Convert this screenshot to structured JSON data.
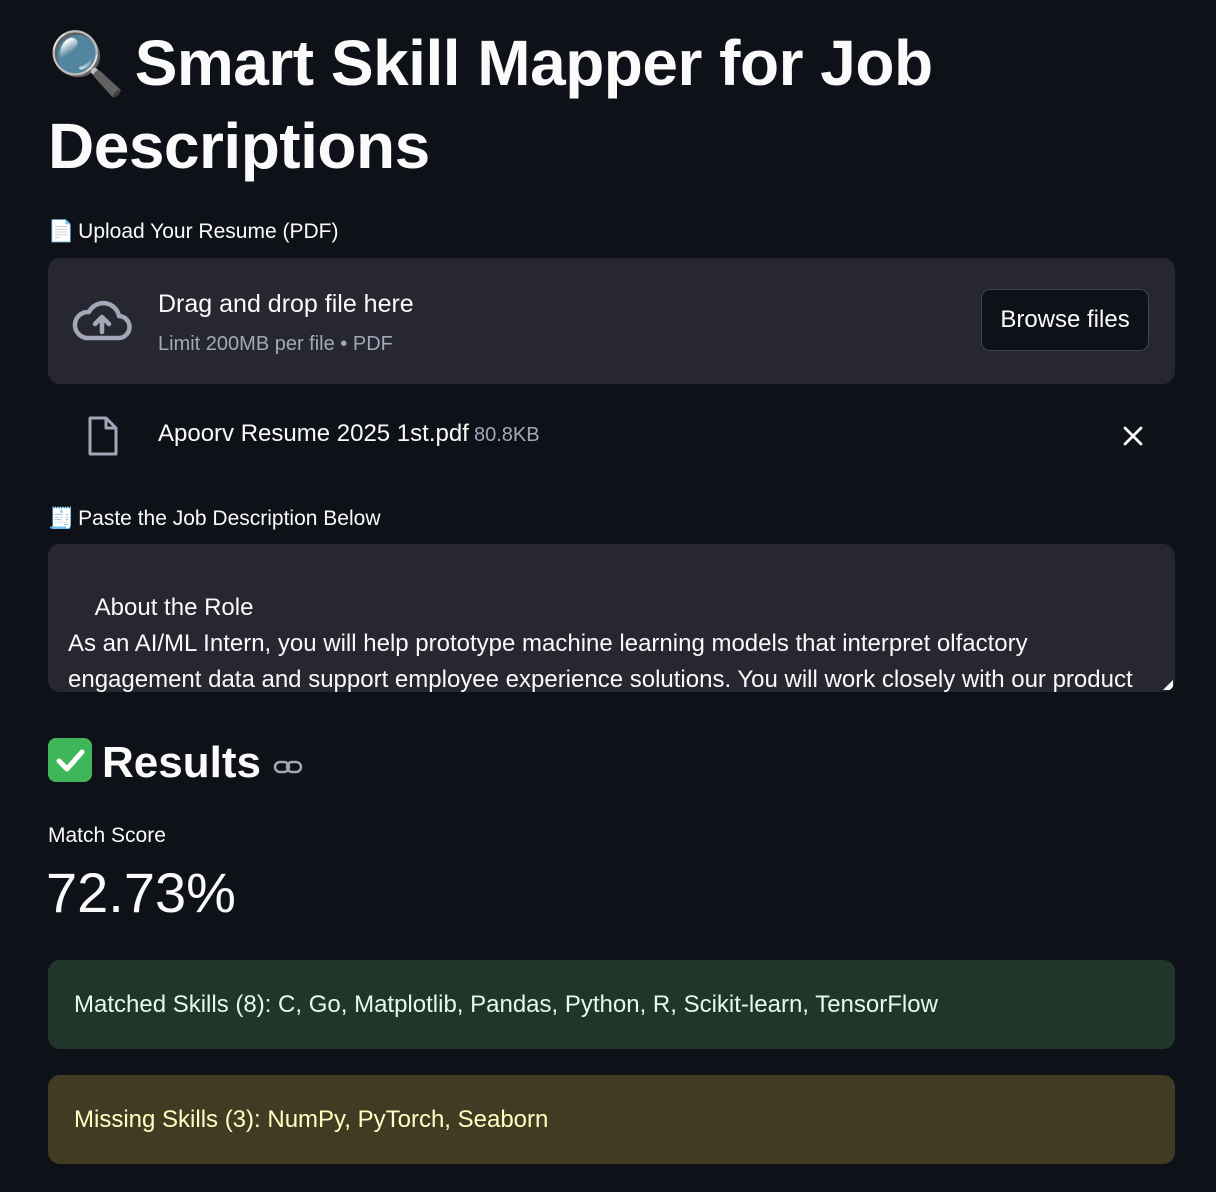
{
  "header": {
    "title_emoji": "🔍",
    "title": "Smart Skill Mapper for Job Descriptions"
  },
  "upload": {
    "label_emoji": "📄",
    "label": "Upload Your Resume (PDF)",
    "dropzone_title": "Drag and drop file here",
    "dropzone_subtitle": "Limit 200MB per file • PDF",
    "browse_label": "Browse files",
    "file": {
      "name": "Apoorv Resume 2025 1st.pdf",
      "size": "80.8KB"
    }
  },
  "job_description": {
    "label_emoji": "🧾",
    "label": "Paste the Job Description Below",
    "value": "About the Role\nAs an AI/ML Intern, you will help prototype machine learning models that interpret olfactory engagement data and support employee experience solutions. You will work closely with our product and technical teams to research, build, and test early-stage models."
  },
  "results": {
    "heading": "Results",
    "metric_label": "Match Score",
    "metric_value": "72.73%",
    "matched": "Matched Skills (8): C, Go, Matplotlib, Pandas, Python, R, Scikit-learn, TensorFlow",
    "missing": "Missing Skills (3): NumPy, PyTorch, Seaborn"
  },
  "colors": {
    "background": "#0e1117",
    "surface": "#262730",
    "success_bg": "#21362b",
    "warning_bg": "#413b24"
  }
}
